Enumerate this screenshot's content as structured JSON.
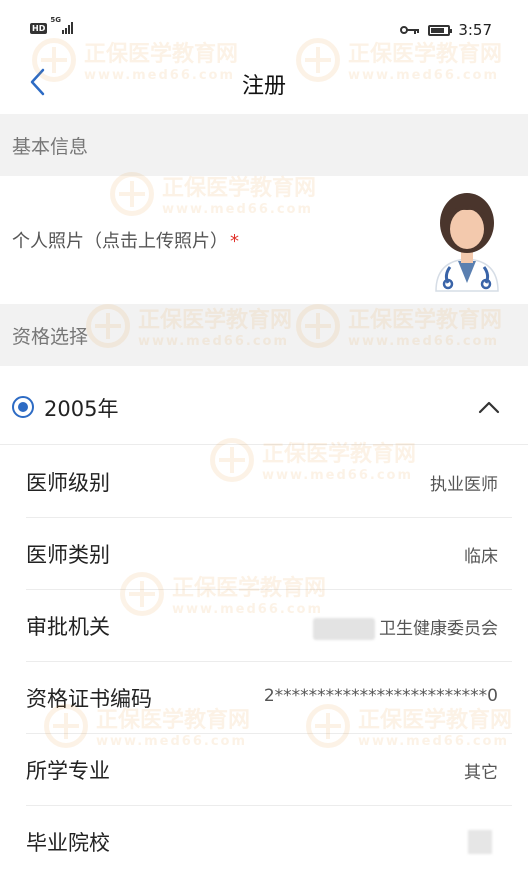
{
  "status_bar": {
    "hd": "HD",
    "network": "5G",
    "time": "3:57"
  },
  "nav": {
    "title": "注册"
  },
  "sections": {
    "basic": "基本信息",
    "qualification": "资格选择"
  },
  "photo": {
    "label": "个人照片（点击上传照片）",
    "required_mark": "*"
  },
  "year": {
    "label": "2005年",
    "selected": true
  },
  "fields": [
    {
      "label": "医师级别",
      "value": "执业医师"
    },
    {
      "label": "医师类别",
      "value": "临床"
    },
    {
      "label": "审批机关",
      "value": "卫生健康委员会"
    },
    {
      "label": "资格证书编码",
      "value": "2*************************0"
    },
    {
      "label": "所学专业",
      "value": "其它"
    },
    {
      "label": "毕业院校",
      "value": ""
    }
  ],
  "watermark": {
    "text": "正保医学教育网",
    "url": "www.med66.com"
  },
  "colors": {
    "accent": "#2d6bc4",
    "required": "#e0312a",
    "section_bg": "#f2f2f2",
    "watermark": "#e58a1a"
  }
}
